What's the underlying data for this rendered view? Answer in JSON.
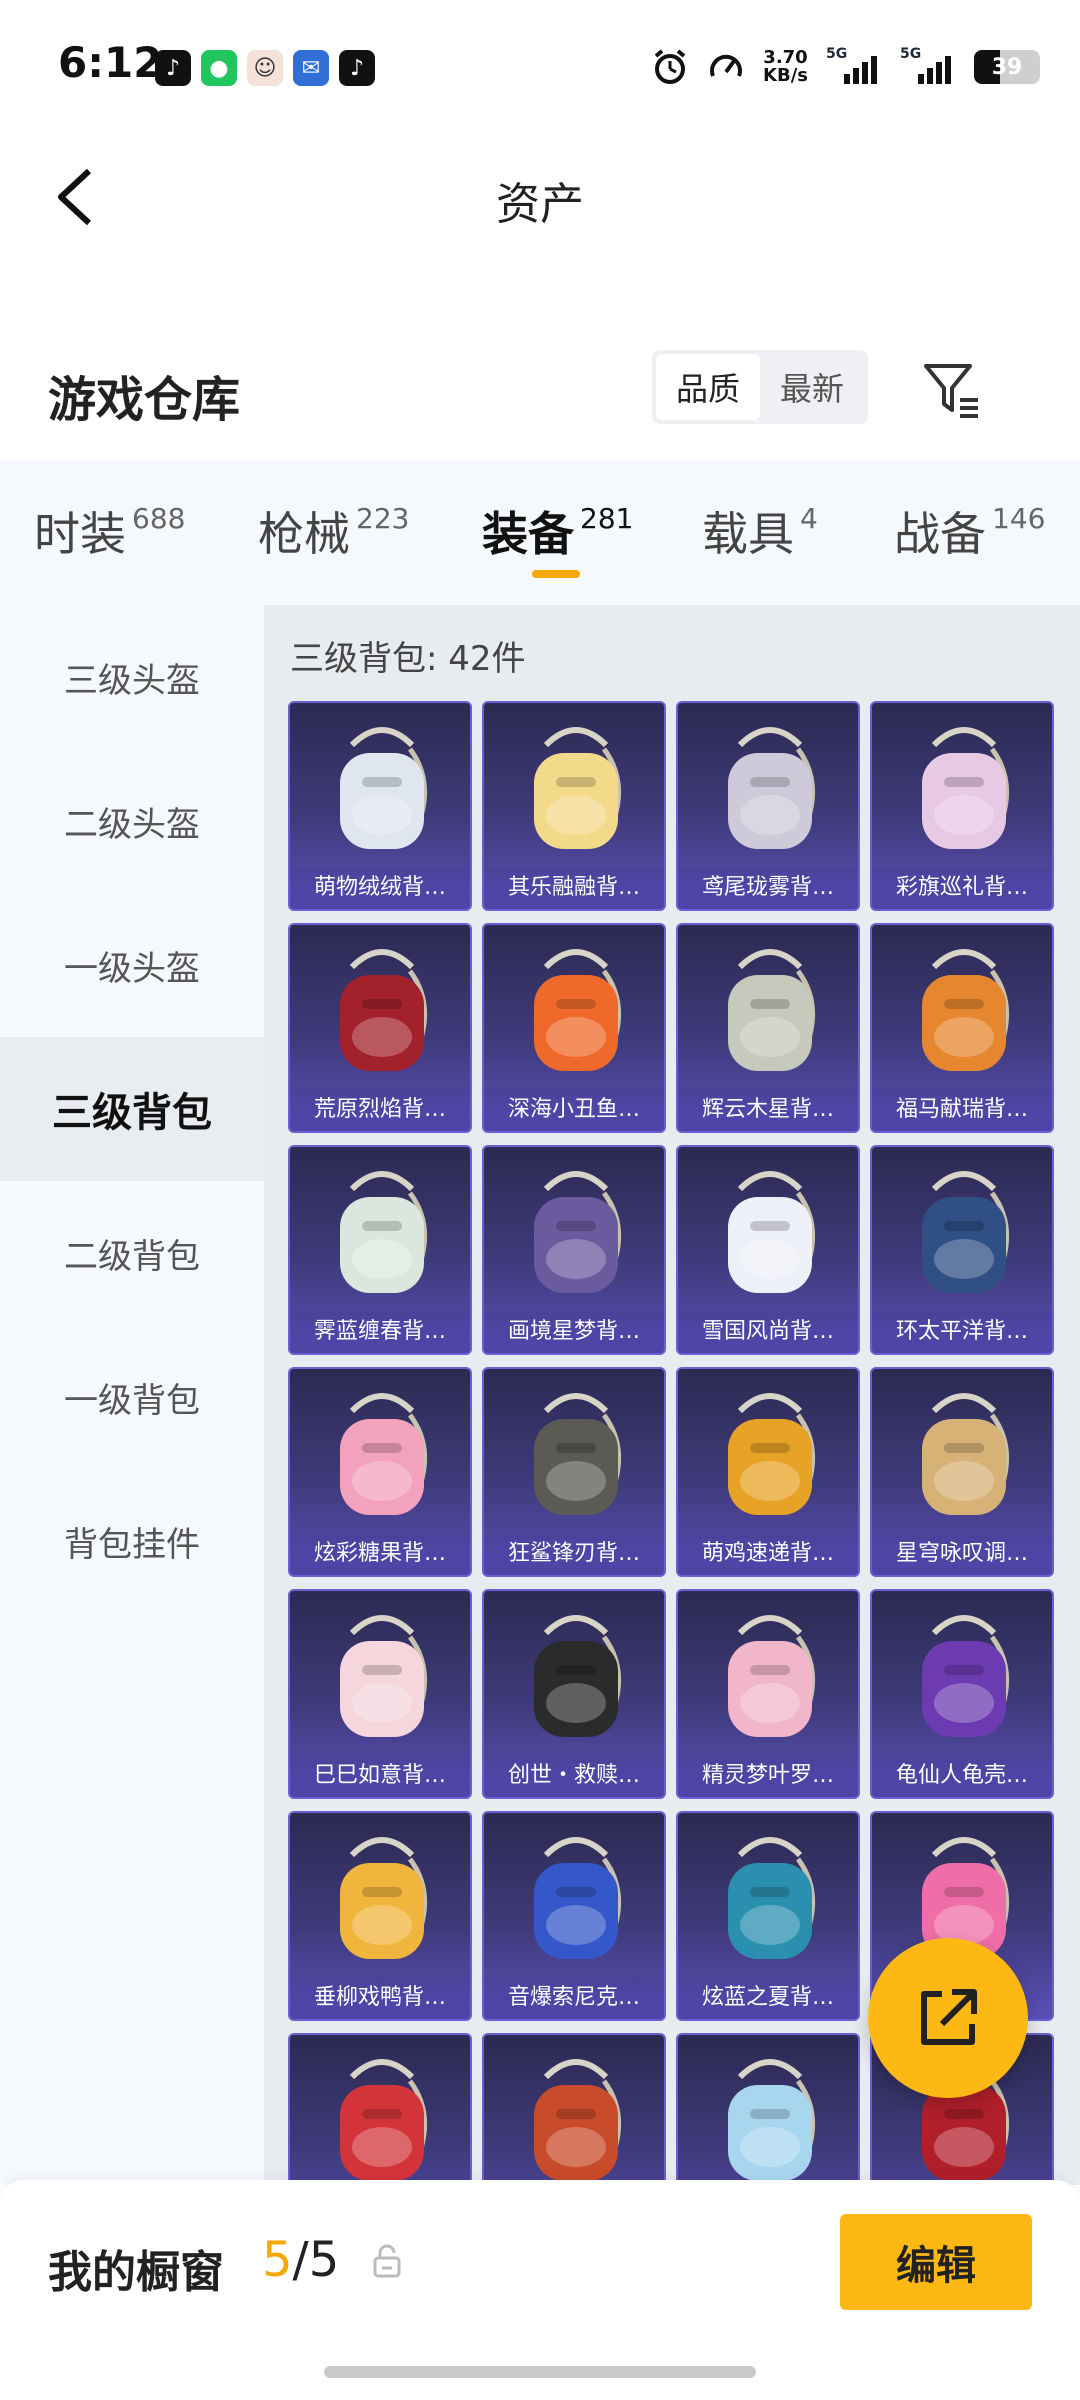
{
  "status_bar": {
    "time": "6:12",
    "speed_value": "3.70",
    "speed_unit": "KB/s",
    "signal_label_1": "5G",
    "signal_label_2": "5G",
    "battery": "39",
    "app_icons": [
      "douyin-icon",
      "wechat-icon",
      "avatar-icon",
      "mail-app-icon",
      "douyin-icon"
    ]
  },
  "header": {
    "title": "资产"
  },
  "warehouse": {
    "title": "游戏仓库",
    "sort_options": [
      "品质",
      "最新"
    ],
    "active_sort": "品质"
  },
  "tabs": [
    {
      "label": "时装",
      "count": "688"
    },
    {
      "label": "枪械",
      "count": "223"
    },
    {
      "label": "装备",
      "count": "281"
    },
    {
      "label": "载具",
      "count": "4"
    },
    {
      "label": "战备",
      "count": "146"
    }
  ],
  "sidebar": {
    "items": [
      "三级头盔",
      "二级头盔",
      "一级头盔",
      "三级背包",
      "二级背包",
      "一级背包",
      "背包挂件"
    ],
    "active": "三级背包"
  },
  "section": {
    "label": "三级背包: 42件"
  },
  "items": [
    {
      "name": "萌物绒绒背…",
      "color": "#dfe6f0"
    },
    {
      "name": "其乐融融背…",
      "color": "#f3d98a"
    },
    {
      "name": "鸢尾珑雾背…",
      "color": "#cfcad9"
    },
    {
      "name": "彩旗巡礼背…",
      "color": "#e7c9e4"
    },
    {
      "name": "荒原烈焰背…",
      "color": "#a3212a"
    },
    {
      "name": "深海小丑鱼…",
      "color": "#ef6a2a"
    },
    {
      "name": "辉云木星背…",
      "color": "#c6c9bc"
    },
    {
      "name": "福马献瑞背…",
      "color": "#e6862f"
    },
    {
      "name": "霁蓝缠春背…",
      "color": "#dbe7de"
    },
    {
      "name": "画境星梦背…",
      "color": "#6a5a9e"
    },
    {
      "name": "雪国风尚背…",
      "color": "#eef0f8"
    },
    {
      "name": "环太平洋背…",
      "color": "#2f4f85"
    },
    {
      "name": "炫彩糖果背…",
      "color": "#f2a2bd"
    },
    {
      "name": "狂鲨锋刃背…",
      "color": "#5b5a55"
    },
    {
      "name": "萌鸡速递背…",
      "color": "#e7a325"
    },
    {
      "name": "星穹咏叹调…",
      "color": "#d7b277"
    },
    {
      "name": "巳巳如意背…",
      "color": "#f4d6dc"
    },
    {
      "name": "创世・救赎…",
      "color": "#2b2b2b"
    },
    {
      "name": "精灵梦叶罗…",
      "color": "#f1b6c9"
    },
    {
      "name": "龟仙人龟壳…",
      "color": "#6c3bb1"
    },
    {
      "name": "垂柳戏鸭背…",
      "color": "#f0b53c"
    },
    {
      "name": "音爆索尼克…",
      "color": "#3457c9"
    },
    {
      "name": "炫蓝之夏背…",
      "color": "#2b8fb0"
    },
    {
      "name": "",
      "color": "#f06ea8"
    },
    {
      "name": "",
      "color": "#d3343a"
    },
    {
      "name": "",
      "color": "#c84b2b"
    },
    {
      "name": "",
      "color": "#a9d6ef"
    },
    {
      "name": "",
      "color": "#b01f2a"
    }
  ],
  "showcase": {
    "label": "我的橱窗",
    "current": "5",
    "separator": "/",
    "total": "5",
    "edit_label": "编辑"
  },
  "colors": {
    "accent": "#fdb813",
    "card_border": "#6c5fd6"
  }
}
